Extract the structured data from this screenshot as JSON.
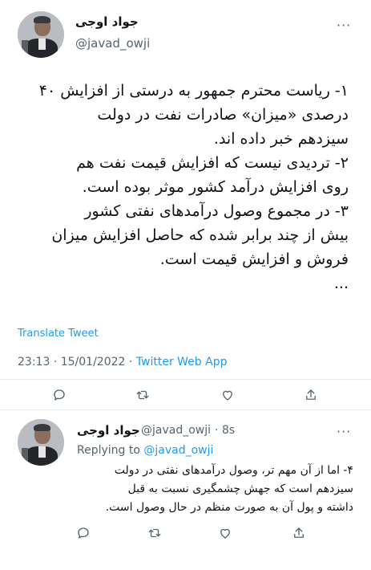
{
  "main_tweet": {
    "display_name": "جواد اوجی",
    "handle": "@javad_owji",
    "more_icon": "···",
    "lines": [
      "۱- ریاست محترم جمهور به درستی از افزایش ۴۰",
      "درصدی «میزان» صادرات نفت در دولت",
      "سیزدهم خبر داده اند.",
      "۲- تردیدی نیست که افزایش قیمت نفت هم",
      "روی افزایش درآمد کشور موثر بوده است.",
      "۳- در مجموع وصول درآمدهای نفتی کشور",
      "بیش از چند برابر شده که حاصل افزایش میزان",
      "فروش و افزایش قیمت است.",
      "..."
    ],
    "translate": "Translate Tweet",
    "time": "23:13",
    "date": "15/01/2022",
    "source": "Twitter Web App",
    "actions": [
      "comment-icon",
      "retweet-icon",
      "like-icon",
      "share-icon"
    ]
  },
  "reply_tweet": {
    "display_name": "جواد اوجی",
    "handle": "@javad_owji",
    "age": "8s",
    "replying_label": "Replying to",
    "replying_to": "@javad_owji",
    "more_icon": "···",
    "lines": [
      "۴- اما از آن مهم تر، وصول درآمدهای نفتی در دولت",
      "سیزدهم است که جهش چشمگیری نسبت به قبل",
      "داشته و پول آن به صورت منظم در حال وصول است."
    ],
    "actions": [
      "comment-icon",
      "retweet-icon",
      "like-icon",
      "share-icon"
    ]
  },
  "colors": {
    "link": "#1d9bf0",
    "muted": "#536471",
    "text": "#0f1419"
  }
}
